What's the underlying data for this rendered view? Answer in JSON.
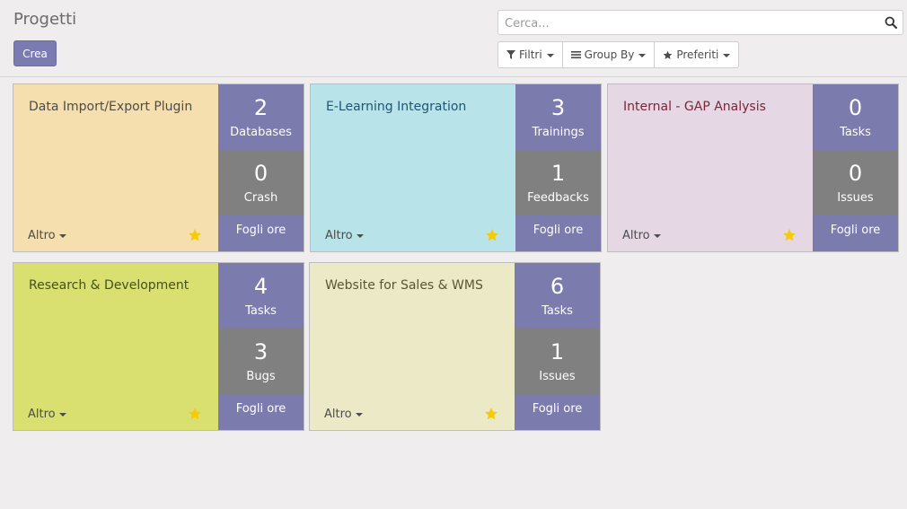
{
  "page": {
    "title": "Progetti",
    "create_label": "Crea"
  },
  "search": {
    "placeholder": "Cerca..."
  },
  "filters": {
    "filters_label": "Filtri",
    "groupby_label": "Group By",
    "favorites_label": "Preferiti"
  },
  "colors": {
    "accent": "#7c7bad",
    "stat_gray": "#808080",
    "star": "#f5cb08"
  },
  "projects": [
    {
      "name": "Data Import/Export Plugin",
      "bg": "#f5dfae",
      "name_color": "#4c4c4c",
      "stat1": {
        "value": "2",
        "label": "Databases"
      },
      "stat2": {
        "value": "0",
        "label": "Crash"
      },
      "timesheet": "Fogli ore",
      "more": "Altro",
      "favorite": true
    },
    {
      "name": "E-Learning Integration",
      "bg": "#b8e3e8",
      "name_color": "#1f5574",
      "stat1": {
        "value": "3",
        "label": "Trainings"
      },
      "stat2": {
        "value": "1",
        "label": "Feedbacks"
      },
      "timesheet": "Fogli ore",
      "more": "Altro",
      "favorite": true
    },
    {
      "name": "Internal - GAP Analysis",
      "bg": "#e6d7e4",
      "name_color": "#7a2638",
      "stat1": {
        "value": "0",
        "label": "Tasks"
      },
      "stat2": {
        "value": "0",
        "label": "Issues"
      },
      "timesheet": "Fogli ore",
      "more": "Altro",
      "favorite": true
    },
    {
      "name": "Research & Development",
      "bg": "#d9e070",
      "name_color": "#44501e",
      "stat1": {
        "value": "4",
        "label": "Tasks"
      },
      "stat2": {
        "value": "3",
        "label": "Bugs"
      },
      "timesheet": "Fogli ore",
      "more": "Altro",
      "favorite": true
    },
    {
      "name": "Website for Sales & WMS",
      "bg": "#ece9c6",
      "name_color": "#5b5533",
      "stat1": {
        "value": "6",
        "label": "Tasks"
      },
      "stat2": {
        "value": "1",
        "label": "Issues"
      },
      "timesheet": "Fogli ore",
      "more": "Altro",
      "favorite": true
    }
  ]
}
